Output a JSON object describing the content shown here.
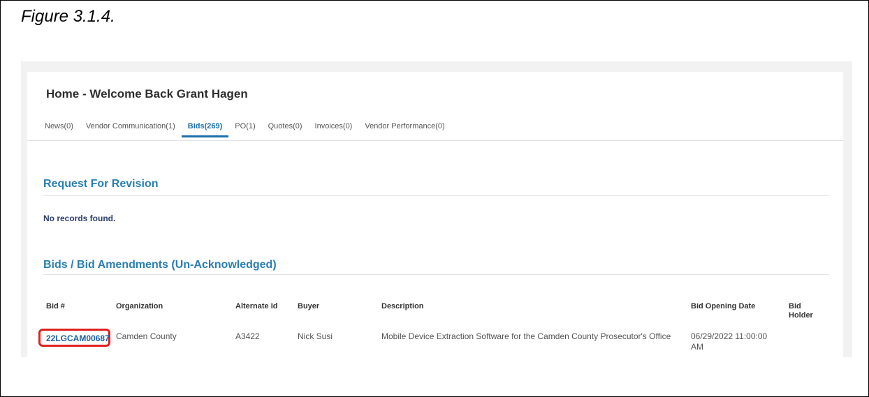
{
  "caption": "Figure 3.1.4.",
  "page": {
    "title": "Home - Welcome Back Grant Hagen"
  },
  "tabs": [
    {
      "label": "News(0)",
      "active": false
    },
    {
      "label": "Vendor Communication(1)",
      "active": false
    },
    {
      "label": "Bids(269)",
      "active": true
    },
    {
      "label": "PO(1)",
      "active": false
    },
    {
      "label": "Quotes(0)",
      "active": false
    },
    {
      "label": "Invoices(0)",
      "active": false
    },
    {
      "label": "Vendor Performance(0)",
      "active": false
    }
  ],
  "request_for_revision": {
    "title": "Request For Revision",
    "empty_text": "No records found."
  },
  "bids": {
    "title": "Bids / Bid Amendments (Un-Acknowledged)",
    "columns": {
      "bid_number": "Bid #",
      "organization": "Organization",
      "alternate_id": "Alternate Id",
      "buyer": "Buyer",
      "description": "Description",
      "bid_opening_date": "Bid Opening Date",
      "bid_holder": "Bid Holder"
    },
    "rows": [
      {
        "bid_number": "22LGCAM00687",
        "organization": "Camden County",
        "alternate_id": "A3422",
        "buyer": "Nick Susi",
        "description": "Mobile Device Extraction Software for the Camden County Prosecutor's Office",
        "bid_opening_date": "06/29/2022 11:00:00 AM",
        "bid_holder": ""
      }
    ]
  },
  "colors": {
    "accent": "#1d6fa8",
    "highlight": "#e0201f",
    "section_title": "#2a7fb0"
  }
}
